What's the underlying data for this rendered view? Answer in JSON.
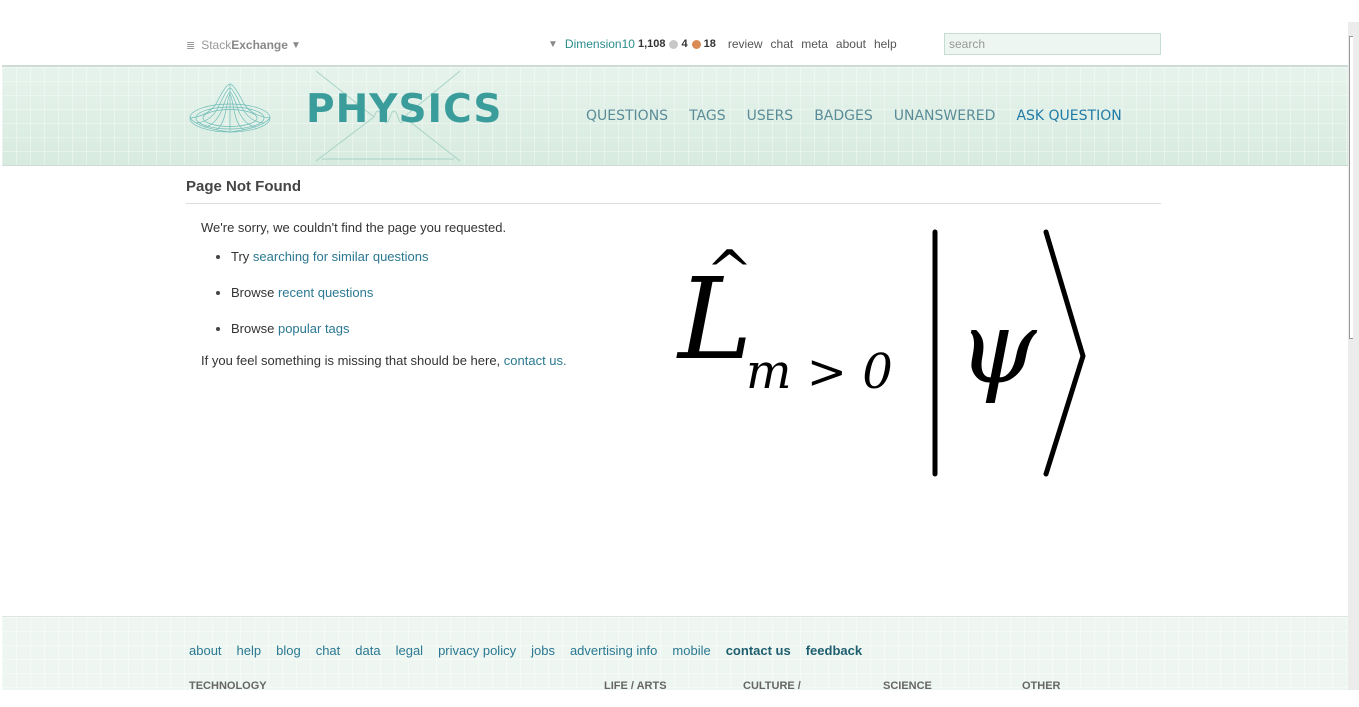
{
  "topbar": {
    "network_logo": {
      "prefix": "Stack",
      "bold": "Exchange",
      "caret": "▼",
      "menu_icon": "≣"
    },
    "user": {
      "caret": "▼",
      "name": "Dimension10",
      "reputation": "1,108",
      "silver_badges": "4",
      "bronze_badges": "18"
    },
    "links": [
      "review",
      "chat",
      "meta",
      "about",
      "help"
    ],
    "search": {
      "placeholder": "search",
      "value": ""
    }
  },
  "header": {
    "site_name": "PHYSICS",
    "nav": [
      "QUESTIONS",
      "TAGS",
      "USERS",
      "BADGES",
      "UNANSWERED"
    ],
    "ask_question": "ASK QUESTION"
  },
  "main": {
    "title": "Page Not Found",
    "apology": "We're sorry, we couldn't find the page you requested.",
    "suggestions": [
      {
        "prefix": "Try ",
        "link": "searching for similar questions"
      },
      {
        "prefix": "Browse ",
        "link": "recent questions"
      },
      {
        "prefix": "Browse ",
        "link": "popular tags"
      }
    ],
    "missing_text": "If you feel something is missing that should be here, ",
    "contact_link": "contact us",
    "contact_suffix": ".",
    "formula": {
      "operator": "L",
      "hat": "^",
      "subscript": "m > 0",
      "ket_symbol": "ψ"
    }
  },
  "footer": {
    "links": [
      "about",
      "help",
      "blog",
      "chat",
      "data",
      "legal",
      "privacy policy",
      "jobs",
      "advertising info",
      "mobile"
    ],
    "bold_links": [
      "contact us",
      "feedback"
    ],
    "categories": [
      "TECHNOLOGY",
      "LIFE / ARTS",
      "CULTURE /",
      "SCIENCE",
      "OTHER"
    ]
  },
  "colors": {
    "brand_teal": "#3a9d9b",
    "link": "#2a7891",
    "ask_question": "#1f7ba6",
    "nav": "#5a8c98",
    "header_bg": "#e0efe7",
    "silver_badge": "#c8c8c8",
    "bronze_badge": "#d98a55"
  }
}
